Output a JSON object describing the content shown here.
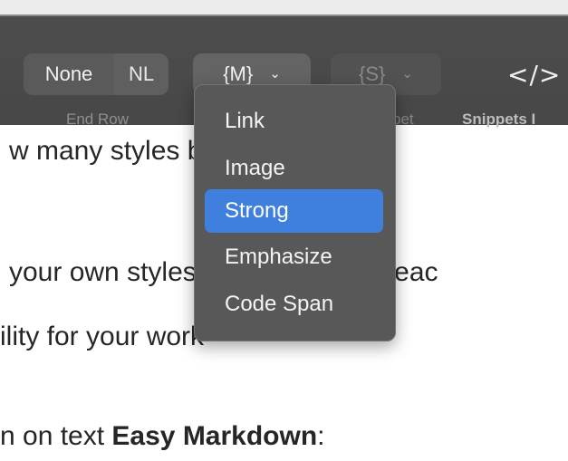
{
  "toolbar": {
    "segment_none": "None",
    "segment_nl": "NL",
    "end_row_label": "End Row",
    "markup_dropdown": "{M}",
    "snippet_dropdown": "{S}",
    "snippet_label_partial": "pet",
    "snippets_icon_glyph": "</>",
    "snippets_label": "Snippets I"
  },
  "menu": {
    "items": [
      "Link",
      "Image",
      "Strong",
      "Emphasize",
      "Code Span"
    ],
    "selected": "Strong"
  },
  "document": {
    "line1": "w many styles by specifying th",
    "line2": "your own styles, or make them reac",
    "line3": "ility for your work",
    "line4_prefix": "n on text ",
    "line4_bold": "Easy Markdown",
    "line4_suffix": ":"
  },
  "colors": {
    "toolbar_bg": "#4a4a4a",
    "menu_bg": "#585858",
    "selection": "#3f7fdd"
  }
}
